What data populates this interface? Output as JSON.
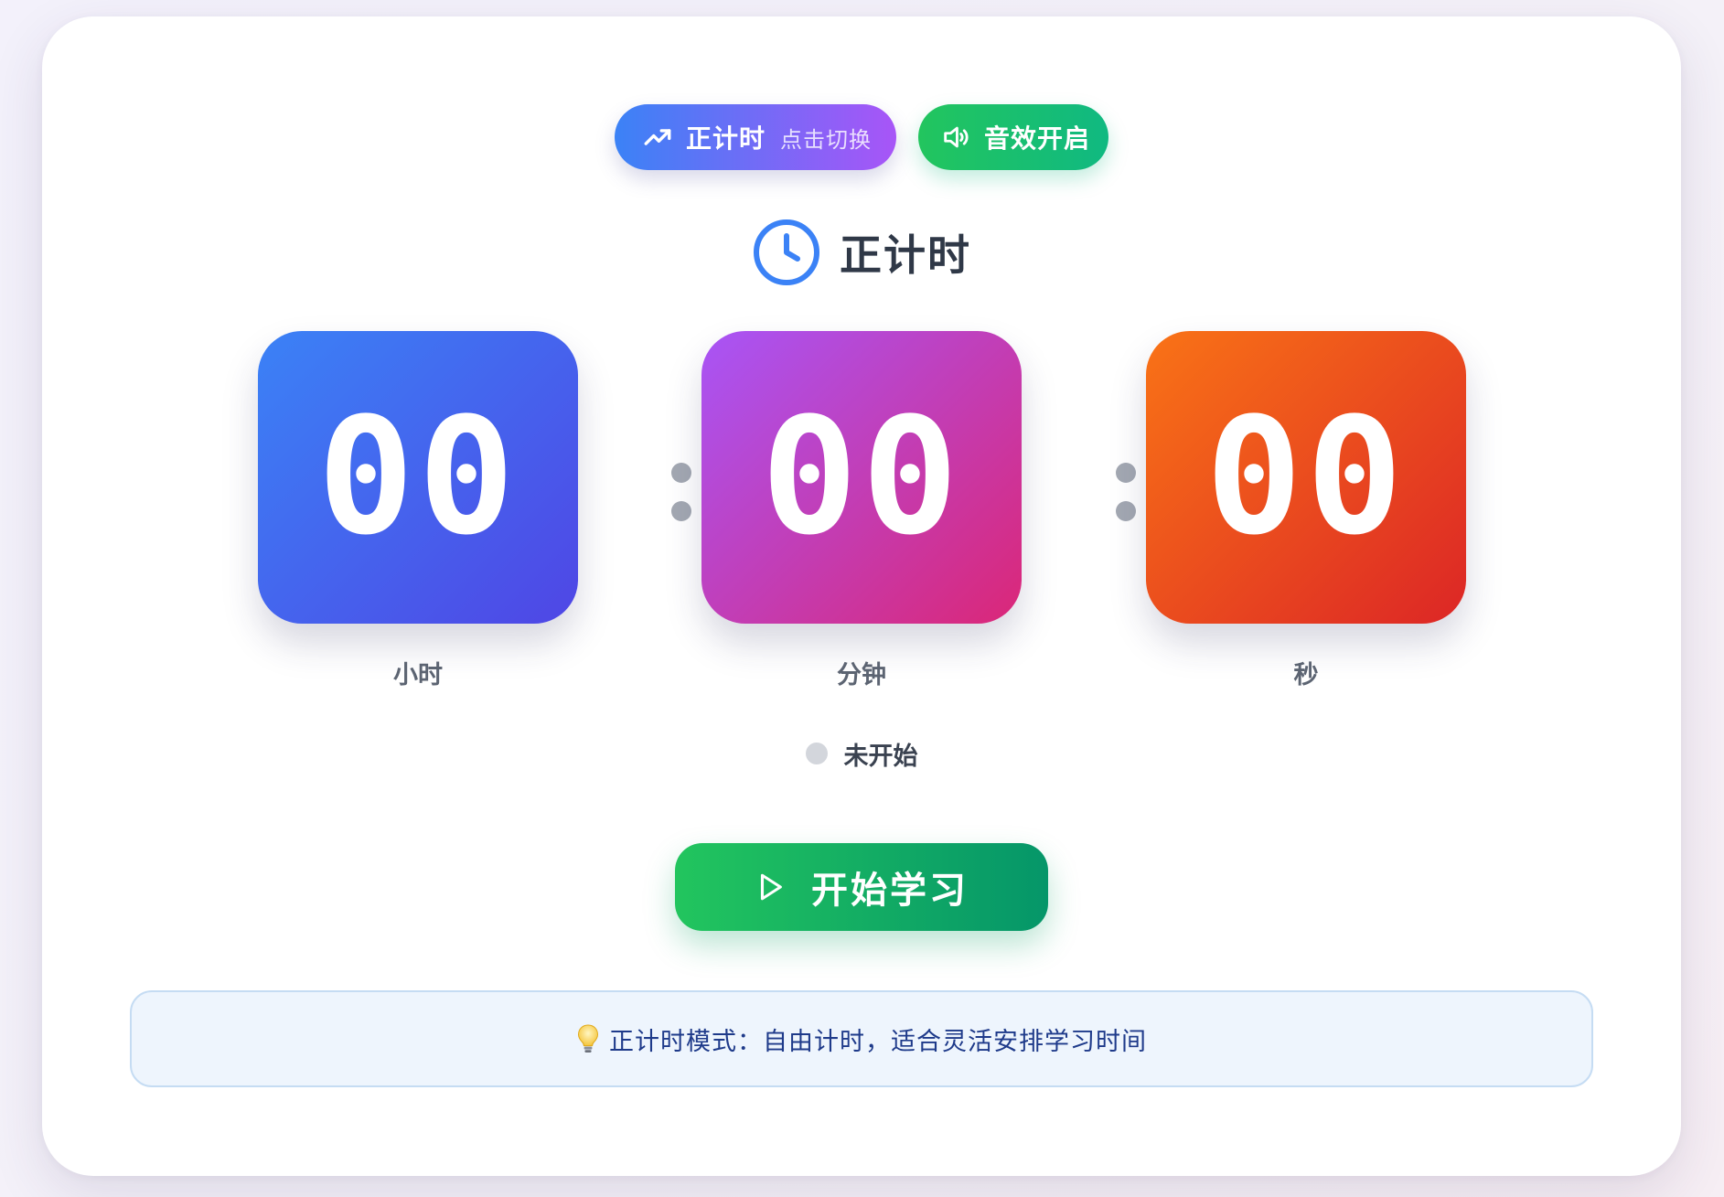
{
  "toolbar": {
    "mode_label": "正计时",
    "mode_hint": "点击切换",
    "sound_label": "音效开启"
  },
  "heading": {
    "title": "正计时"
  },
  "timer": {
    "hours": "00",
    "minutes": "00",
    "seconds": "00",
    "hours_label": "小时",
    "minutes_label": "分钟",
    "seconds_label": "秒"
  },
  "status": {
    "text": "未开始"
  },
  "actions": {
    "start_label": "开始学习"
  },
  "tip": {
    "text": "正计时模式：自由计时，适合灵活安排学习时间"
  },
  "icons": {
    "mode": "trending-up-icon",
    "sound": "volume-icon",
    "heading": "clock-icon",
    "start": "play-icon",
    "tip": "lightbulb-icon"
  },
  "colors": {
    "mode_gradient": [
      "#3b82f6",
      "#a855f7"
    ],
    "sound_gradient": [
      "#22c55e",
      "#10b981"
    ],
    "hours_tile": [
      "#3b82f6",
      "#4f46e5"
    ],
    "minutes_tile": [
      "#a855f7",
      "#db2777"
    ],
    "seconds_tile": [
      "#f97316",
      "#dc2626"
    ],
    "start_gradient": [
      "#22c55e",
      "#059669"
    ],
    "status_dot": "#d3d6dc",
    "tip_background": "#eef5fd",
    "tip_text": "#1e3a8a"
  }
}
